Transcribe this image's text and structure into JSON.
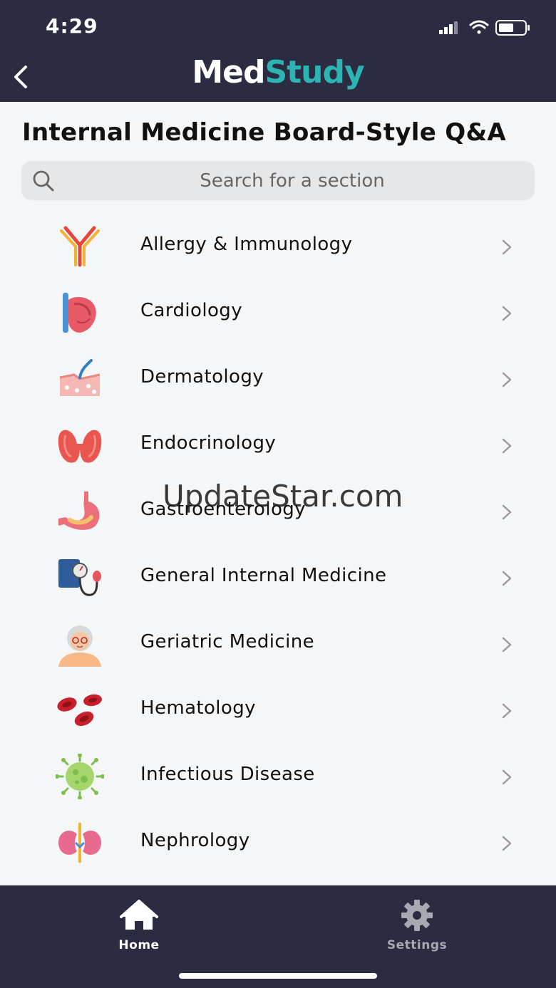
{
  "status_bar": {
    "time": "4:29"
  },
  "header": {
    "logo_part1": "Med",
    "logo_part2": "Study"
  },
  "page": {
    "title": "Internal Medicine Board-Style Q&A"
  },
  "search": {
    "placeholder": "Search for a section"
  },
  "sections": [
    {
      "label": "Allergy & Immunology",
      "icon": "antibody-icon"
    },
    {
      "label": "Cardiology",
      "icon": "heart-icon"
    },
    {
      "label": "Dermatology",
      "icon": "skin-layer-icon"
    },
    {
      "label": "Endocrinology",
      "icon": "thyroid-icon"
    },
    {
      "label": "Gastroenterology",
      "icon": "stomach-icon"
    },
    {
      "label": "General Internal Medicine",
      "icon": "blood-pressure-cuff-icon"
    },
    {
      "label": "Geriatric Medicine",
      "icon": "elderly-woman-icon"
    },
    {
      "label": "Hematology",
      "icon": "red-blood-cells-icon"
    },
    {
      "label": "Infectious Disease",
      "icon": "virus-icon"
    },
    {
      "label": "Nephrology",
      "icon": "kidneys-icon"
    }
  ],
  "watermark": "UpdateStar.com",
  "tabbar": {
    "home_label": "Home",
    "settings_label": "Settings"
  },
  "colors": {
    "header_bg": "#2b2b42",
    "brand_teal": "#2cb4b2",
    "background": "#f4f6f8"
  }
}
